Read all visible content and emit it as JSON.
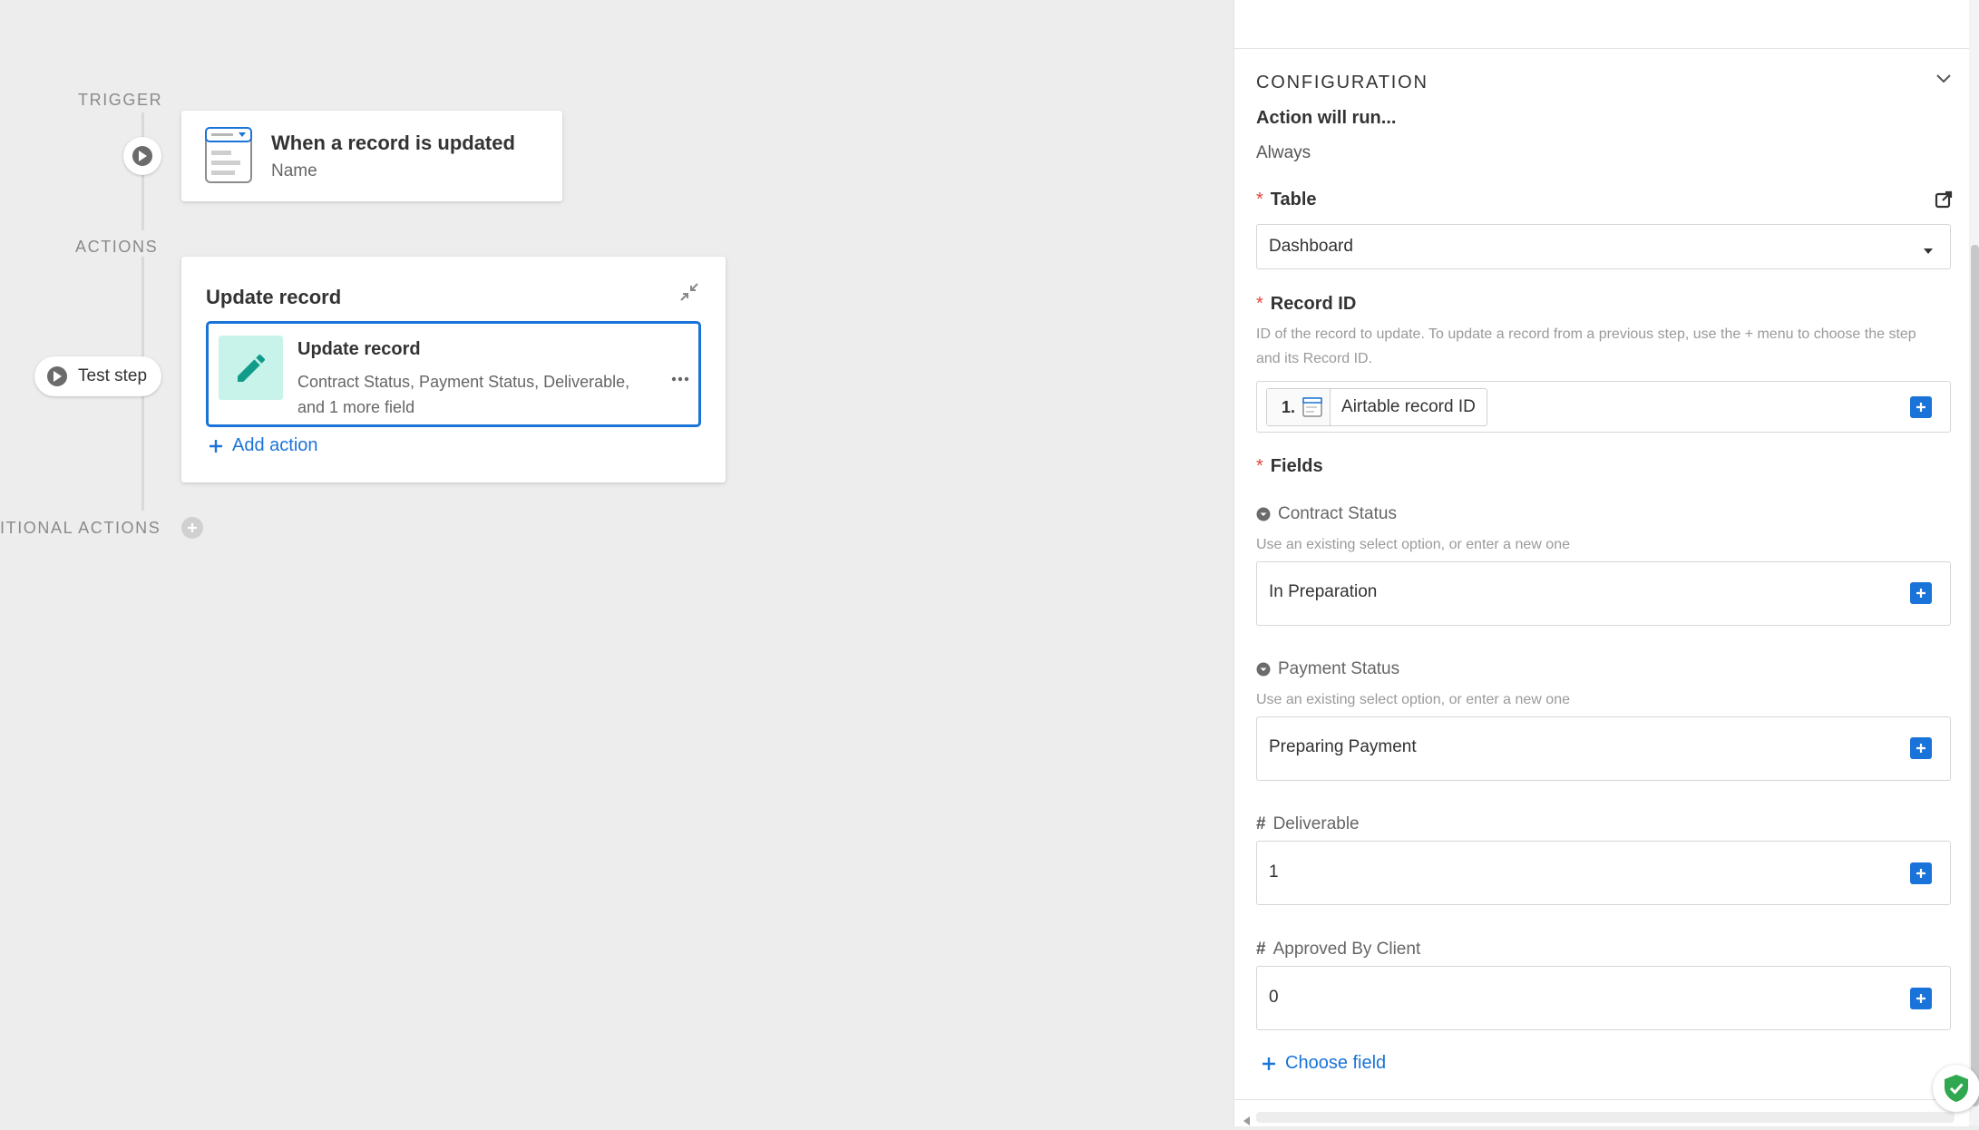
{
  "canvas": {
    "labels": {
      "trigger": "TRIGGER",
      "actions": "ACTIONS",
      "conditional": "ITIONAL ACTIONS"
    },
    "trigger_card": {
      "title": "When a record is updated",
      "subtitle": "Name"
    },
    "test_step_label": "Test step",
    "action_group": {
      "title": "Update record",
      "action": {
        "title": "Update record",
        "description_line1": "Contract Status, Payment Status, Deliverable,",
        "description_line2": "and 1 more field"
      },
      "add_action_label": "Add action"
    }
  },
  "panel": {
    "section_title": "CONFIGURATION",
    "run_condition_label": "Action will run...",
    "run_condition_value": "Always",
    "table": {
      "label": "Table",
      "value": "Dashboard"
    },
    "record_id": {
      "label": "Record ID",
      "help_line1": "ID of the record to update. To update a record from a previous step, use the + menu to choose the step",
      "help_line2": "and its Record ID.",
      "token_step": "1.",
      "token_label": "Airtable record ID"
    },
    "fields": {
      "label": "Fields",
      "items": [
        {
          "name": "Contract Status",
          "help": "Use an existing select option, or enter a new one",
          "value": "In Preparation"
        },
        {
          "name": "Payment Status",
          "help": "Use an existing select option, or enter a new one",
          "value": "Preparing Payment"
        },
        {
          "name": "Deliverable",
          "value": "1"
        },
        {
          "name": "Approved By Client",
          "value": "0"
        }
      ],
      "choose_field_label": "Choose field"
    }
  },
  "colors": {
    "accent": "#1a73d8",
    "action_icon_bg": "#c8f3ea",
    "action_icon": "#119c8a",
    "required": "#e0433b",
    "canvas_bg": "#ededed",
    "shield": "#2fa84f"
  }
}
